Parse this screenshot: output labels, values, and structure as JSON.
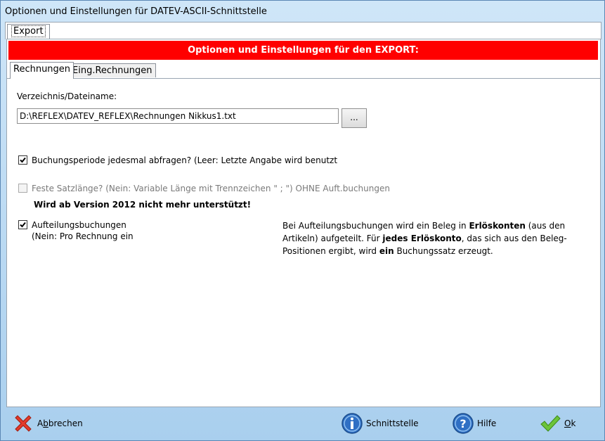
{
  "window": {
    "title": "Optionen und Einstellungen für DATEV-ASCII-Schnittstelle"
  },
  "outer_tab": {
    "label": "Export"
  },
  "banner": {
    "text": "Optionen und Einstellungen für den EXPORT:"
  },
  "inner_tabs": [
    {
      "label": "Rechnungen",
      "active": true
    },
    {
      "label": "Eing.Rechnungen",
      "active": false
    }
  ],
  "form": {
    "dir_label": "Verzeichnis/Dateiname:",
    "dir_value": "D:\\REFLEX\\DATEV_REFLEX\\Rechnungen Nikkus1.txt",
    "browse_label": "...",
    "cb1": {
      "label": "Buchungsperiode jedesmal abfragen? (Leer: Letzte Angabe wird benutzt",
      "checked": true
    },
    "cb2": {
      "label": "Feste Satzlänge? (Nein: Variable Länge mit Trennzeichen \" ; \") OHNE Auft.buchungen",
      "checked": false,
      "disabled": true
    },
    "warning": "Wird ab Version 2012 nicht mehr unterstützt!",
    "cb3": {
      "label_line1": "Aufteilungsbuchungen",
      "label_line2": "(Nein: Pro Rechnung ein",
      "checked": true
    },
    "info": {
      "p1": "Bei Aufteilungsbuchungen wird ein Beleg in ",
      "b1": "Erlöskonten",
      "p2": " (aus den Artikeln) aufgeteilt. Für ",
      "b2": "jedes Erlöskonto",
      "p3": ", das sich aus den Beleg-Positionen ergibt, wird ",
      "b3": "ein",
      "p4": " Buchungssatz erzeugt."
    }
  },
  "buttons": {
    "cancel": {
      "pre": "A",
      "u": "b",
      "post": "brechen",
      "icon": "red-x-icon"
    },
    "interface": {
      "label": "Schnittstelle",
      "icon": "info-icon"
    },
    "help": {
      "label": "Hilfe",
      "icon": "help-icon"
    },
    "ok": {
      "u": "O",
      "post": "k",
      "icon": "green-check-icon"
    }
  },
  "colors": {
    "banner": "#ff0000",
    "window_bg": "#a9cfee",
    "check": "#1a7f1a"
  }
}
